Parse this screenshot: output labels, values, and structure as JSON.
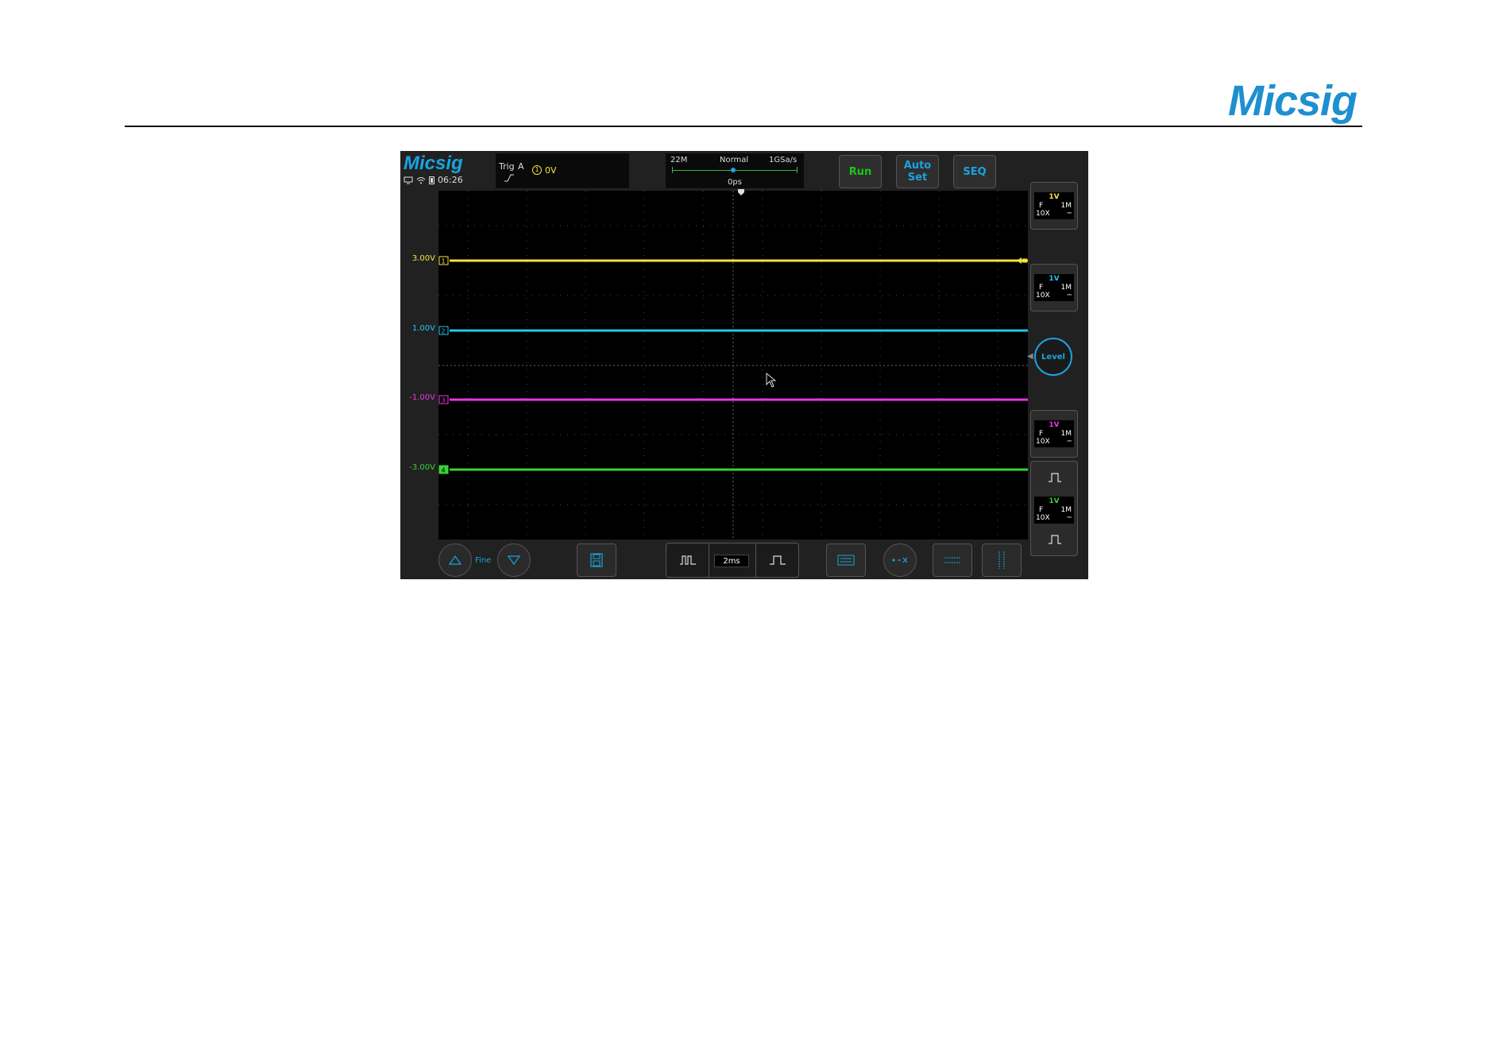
{
  "page": {
    "brand_logo": "Micsig"
  },
  "scope": {
    "logo": "Micsig",
    "status": {
      "time": "06:26"
    },
    "trigger": {
      "label": "Trig",
      "source": "A",
      "channel_badge": "1",
      "level": "0V"
    },
    "acquisition": {
      "memory_depth": "22M",
      "mode": "Normal",
      "sample_rate": "1GSa/s",
      "delay": "0ps"
    },
    "buttons": {
      "run": "Run",
      "autoset": "Auto Set",
      "seq": "SEQ"
    },
    "channels": [
      {
        "id": "1",
        "offset_label": "3.00V",
        "scale": "1V",
        "bandwidth": "F",
        "impedance": "1M",
        "probe": "10X",
        "color": "#f2e43b"
      },
      {
        "id": "2",
        "offset_label": "1.00V",
        "scale": "1V",
        "bandwidth": "F",
        "impedance": "1M",
        "probe": "10X",
        "color": "#27c6e8"
      },
      {
        "id": "3",
        "offset_label": "-1.00V",
        "scale": "1V",
        "bandwidth": "F",
        "impedance": "1M",
        "probe": "10X",
        "color": "#e637e6"
      },
      {
        "id": "4",
        "offset_label": "-3.00V",
        "scale": "1V",
        "bandwidth": "F",
        "impedance": "1M",
        "probe": "10X",
        "color": "#39d139"
      }
    ],
    "level_knob": "Level",
    "bottom": {
      "fine": "Fine",
      "timebase": "2ms"
    },
    "icons": [
      "monitor-icon",
      "wifi-icon",
      "battery-icon",
      "rising-edge-icon",
      "save-icon",
      "measure-icon",
      "math-icon",
      "horizontal-cursor-icon",
      "vertical-cursor-icon",
      "pulse-icon",
      "cursor-pointer-icon"
    ]
  }
}
